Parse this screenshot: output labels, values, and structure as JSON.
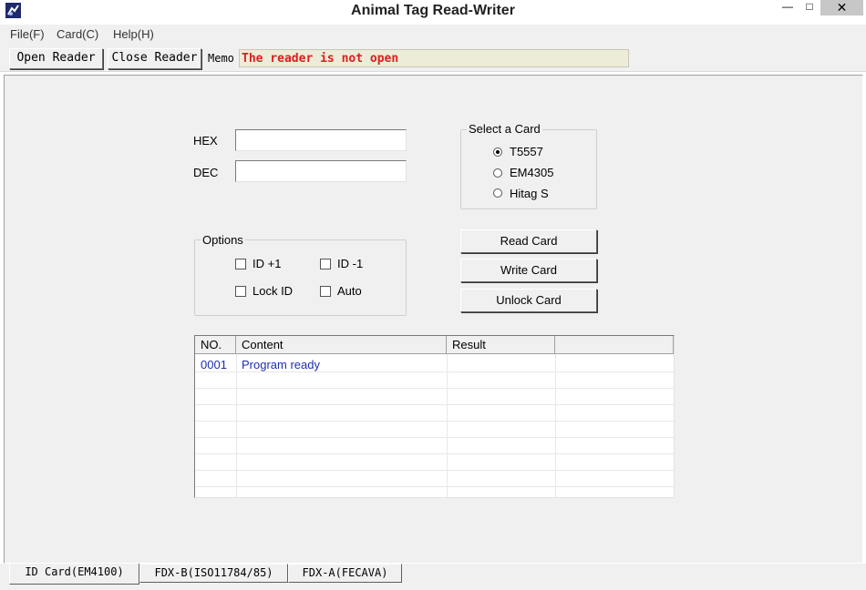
{
  "window": {
    "title": "Animal Tag Read-Writer"
  },
  "menu": {
    "file": "File(F)",
    "card": "Card(C)",
    "help": "Help(H)"
  },
  "toolbar": {
    "open_label": "Open Reader",
    "close_label": "Close Reader",
    "memo_label": "Memo",
    "memo_text": "The reader is not open"
  },
  "fields": {
    "hex_label": "HEX",
    "dec_label": "DEC",
    "hex_value": "",
    "dec_value": ""
  },
  "select_card": {
    "title": "Select a Card",
    "options": [
      {
        "label": "T5557",
        "selected": true
      },
      {
        "label": "EM4305",
        "selected": false
      },
      {
        "label": "Hitag S",
        "selected": false
      }
    ]
  },
  "options": {
    "title": "Options",
    "id_plus": "ID +1",
    "id_minus": "ID -1",
    "lock_id": "Lock ID",
    "auto": "Auto"
  },
  "buttons": {
    "read": "Read Card",
    "write": "Write Card",
    "unlock": "Unlock Card"
  },
  "log": {
    "columns": [
      "NO.",
      "Content",
      "Result"
    ],
    "rows": [
      {
        "no": "0001",
        "content": "Program ready",
        "result": ""
      }
    ]
  },
  "tabs": [
    "ID Card(EM4100)",
    "FDX-B(ISO11784/85)",
    "FDX-A(FECAVA)"
  ],
  "colors": {
    "memo_text": "#dc1e1e",
    "log_text": "#1f2db4",
    "memo_bg": "#ececd8"
  }
}
